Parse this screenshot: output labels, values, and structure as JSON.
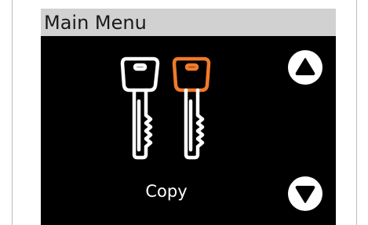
{
  "screen": {
    "title": "Main Menu",
    "item_label": "Copy",
    "item_icon": "two-keys-icon"
  },
  "navigation": {
    "up_icon": "up-arrow-icon",
    "down_icon": "down-arrow-icon"
  },
  "colors": {
    "screen_background": "#000000",
    "title_bar": "#d1d1d1",
    "key_primary": "#ffffff",
    "key_highlight": "#f07a2a",
    "button_fill": "#ffffff"
  }
}
